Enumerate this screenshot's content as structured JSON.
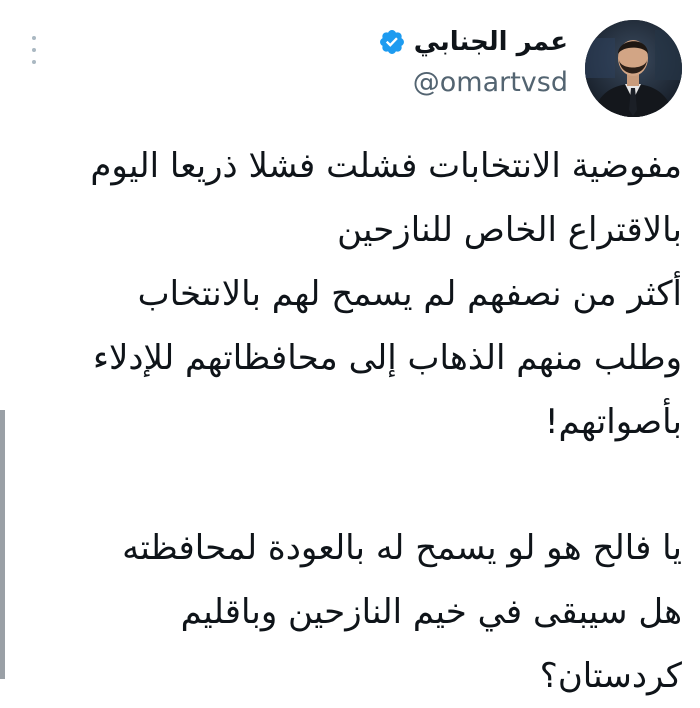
{
  "tweet": {
    "author": {
      "display_name": "عمر الجنابي",
      "handle": "@omartvsd",
      "verified": true,
      "verified_icon": "verified-badge-icon",
      "avatar_icon": "avatar"
    },
    "menu_icon": "more-options-icon",
    "text_lines": [
      "مفوضية الانتخابات فشلت فشلا ذريعا اليوم",
      "بالاقتراع الخاص للنازحين",
      "أكثر من نصفهم لم يسمح لهم بالانتخاب",
      "وطلب منهم الذهاب إلى محافظاتهم للإدلاء",
      "بأصواتهم!",
      "يا فالح هو لو يسمح له بالعودة لمحافظته",
      "هل سيبقى في خيم النازحين وباقليم",
      "كردستان؟"
    ]
  },
  "colors": {
    "text": "#0f1419",
    "secondary": "#536471",
    "verified": "#1d9bf0",
    "menu_dots": "#aab8c2"
  }
}
